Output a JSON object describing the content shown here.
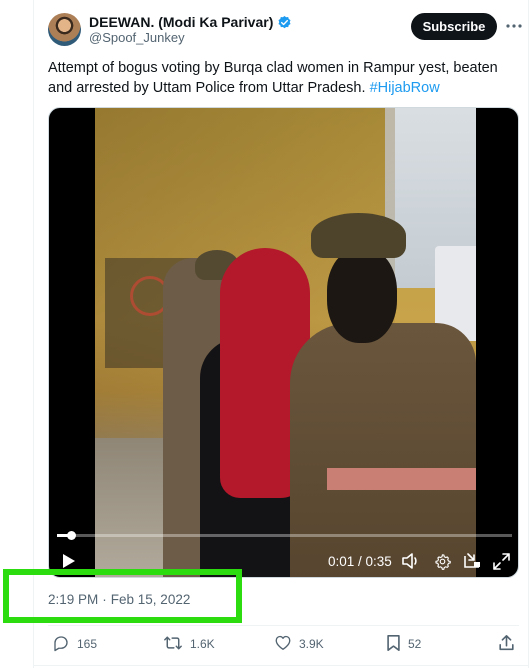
{
  "author": {
    "display_name": "DEEWAN. (Modi Ka Parivar)",
    "handle": "@Spoof_Junkey",
    "verified_icon": "verified-badge-icon",
    "avatar_icon": "avatar"
  },
  "subscribe_label": "Subscribe",
  "more_icon": "more-options-icon",
  "tweet": {
    "text": "Attempt of bogus voting by Burqa clad women in Rampur yest, beaten and arrested by Uttam Police from Uttar Pradesh. ",
    "hashtag": "#HijabRow"
  },
  "video": {
    "current_time": "0:01",
    "duration": "0:35",
    "time_display": "0:01 / 0:35",
    "progress_fraction": 0.03,
    "controls": [
      "play-icon",
      "volume-icon",
      "settings-icon",
      "picture-in-picture-icon",
      "fullscreen-icon"
    ]
  },
  "timestamp": {
    "time": "2:19 PM",
    "separator": "·",
    "date": "Feb 15, 2022"
  },
  "actions": {
    "replies": "165",
    "reposts": "1.6K",
    "likes": "3.9K",
    "bookmarks": "52"
  },
  "colors": {
    "link": "#1d9bf0",
    "muted": "#536471",
    "highlight_box": "#2cdc0e",
    "verified": "#1d9bf0"
  }
}
